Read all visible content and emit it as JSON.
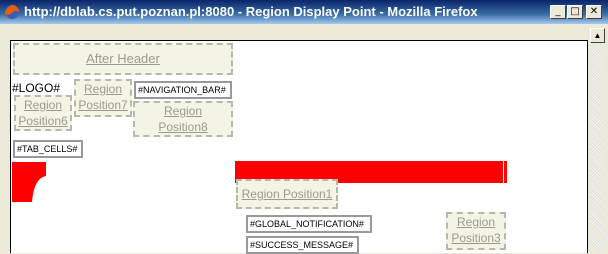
{
  "window": {
    "title": "http://dblab.cs.put.poznan.pl:8080 - Region Display Point - Mozilla Firefox",
    "min_glyph": "_",
    "max_glyph": "□",
    "close_glyph": "✕",
    "icon": "firefox-icon"
  },
  "regions": {
    "after_header": "After Header",
    "logo": "#LOGO#",
    "position6": [
      "Region",
      "Position6"
    ],
    "position7": [
      "Region",
      "Position7"
    ],
    "navigation_bar": "#NAVIGATION_BAR#",
    "position8": [
      "Region",
      "Position8"
    ],
    "tab_cells": "#TAB_CELLS#",
    "position1": "Region Position1",
    "global_notification": "#GLOBAL_NOTIFICATION#",
    "success_message": "#SUCCESS_MESSAGE#",
    "position3": [
      "Region",
      "Position3"
    ]
  },
  "colors": {
    "accent_red": "#ff0000",
    "title_bar": "#0a246a"
  }
}
